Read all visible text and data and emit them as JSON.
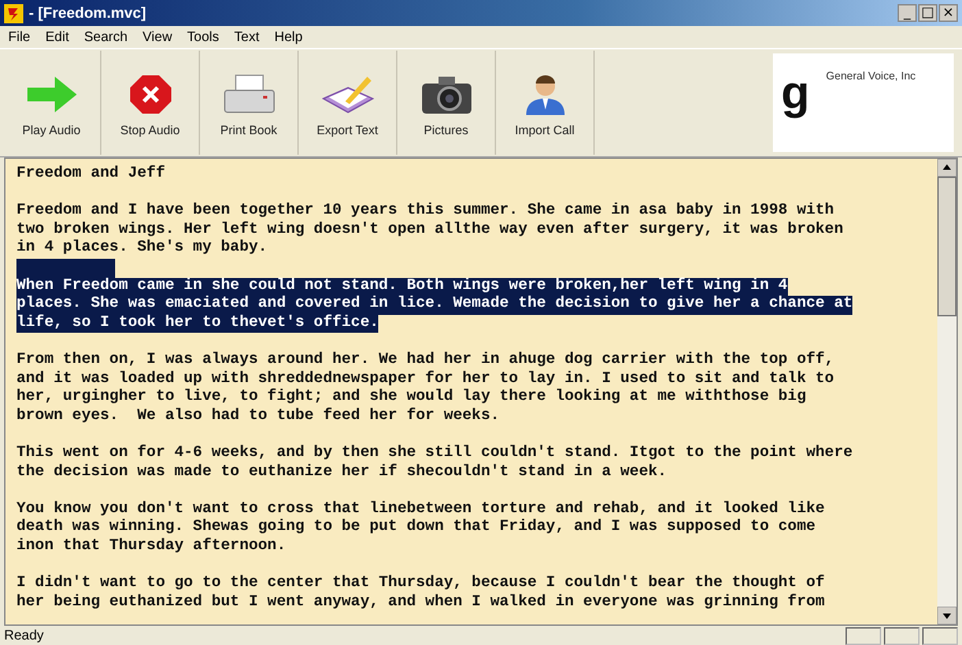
{
  "window": {
    "title": "- [Freedom.mvc]",
    "controls": [
      "_",
      "□",
      "×"
    ]
  },
  "menu": [
    "File",
    "Edit",
    "Search",
    "View",
    "Tools",
    "Text",
    "Help"
  ],
  "toolbar": [
    {
      "label": "Play Audio",
      "kind": "play"
    },
    {
      "label": "Stop Audio",
      "kind": "stop"
    },
    {
      "label": "Print Book",
      "kind": "print"
    },
    {
      "label": "Export Text",
      "kind": "export"
    },
    {
      "label": "Pictures",
      "kind": "camera"
    },
    {
      "label": "Import Call",
      "kind": "person"
    }
  ],
  "logo": {
    "mark": "g",
    "company": "General Voice, Inc"
  },
  "document": {
    "paragraphs": [
      {
        "selected": false,
        "lines": [
          "Freedom and Jeff"
        ]
      },
      {
        "selected": false,
        "lines": [
          "Freedom and I have been together 10 years this summer. She came in asa baby in 1998 with",
          "two broken wings. Her left wing doesn't open allthe way even after surgery, it was broken",
          "in 4 places. She's my baby."
        ]
      },
      {
        "selected": true,
        "lines": [
          "When Freedom came in she could not stand. Both wings were broken,her left wing in 4",
          "places. She was emaciated and covered in lice. Wemade the decision to give her a chance at",
          "life, so I took her to thevet's office."
        ]
      },
      {
        "selected": false,
        "lines": [
          "From then on, I was always around her. We had her in ahuge dog carrier with the top off,",
          "and it was loaded up with shreddednewspaper for her to lay in. I used to sit and talk to",
          "her, urgingher to live, to fight; and she would lay there looking at me withthose big",
          "brown eyes.  We also had to tube feed her for weeks."
        ]
      },
      {
        "selected": false,
        "lines": [
          "This went on for 4-6 weeks, and by then she still couldn't stand. Itgot to the point where",
          "the decision was made to euthanize her if shecouldn't stand in a week."
        ]
      },
      {
        "selected": false,
        "lines": [
          "You know you don't want to cross that linebetween torture and rehab, and it looked like",
          "death was winning. Shewas going to be put down that Friday, and I was supposed to come",
          "inon that Thursday afternoon."
        ]
      },
      {
        "selected": false,
        "lines": [
          "I didn't want to go to the center that Thursday, because I couldn't bear the thought of",
          "her being euthanized but I went anyway, and when I walked in everyone was grinning from"
        ]
      }
    ]
  },
  "status_bar": {
    "text": "Ready"
  }
}
